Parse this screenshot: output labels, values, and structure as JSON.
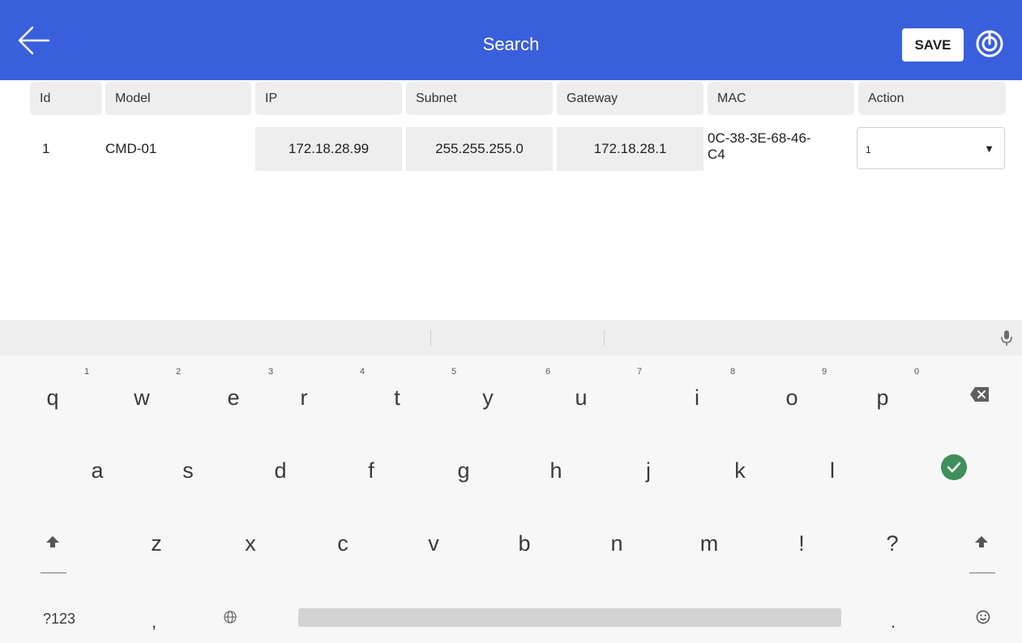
{
  "app_bar": {
    "title": "Search",
    "save_label": "SAVE",
    "back_icon": "back-arrow-icon",
    "power_icon": "power-icon",
    "color": "#3a5fdc"
  },
  "table": {
    "headers": [
      "Id",
      "Model",
      "IP",
      "Subnet",
      "Gateway",
      "MAC",
      "Action"
    ],
    "row": {
      "id": "1",
      "model": "CMD-01",
      "ip": "172.18.28.99",
      "subnet": "255.255.255.0",
      "gateway": "172.18.28.1",
      "mac_line1": "0C-38-3E-68-46-",
      "mac_line2": "C4",
      "action_value": "1",
      "action_caret": "▼"
    }
  },
  "keyboard": {
    "row1": [
      {
        "key": "q",
        "hint": "1"
      },
      {
        "key": "w",
        "hint": "2"
      },
      {
        "key": "e",
        "hint": "3"
      },
      {
        "key": "r",
        "hint": "4"
      },
      {
        "key": "t",
        "hint": "5"
      },
      {
        "key": "y",
        "hint": "6"
      },
      {
        "key": "u",
        "hint": "7"
      },
      {
        "key": "i",
        "hint": "8"
      },
      {
        "key": "o",
        "hint": "9"
      },
      {
        "key": "p",
        "hint": "0"
      }
    ],
    "row2": [
      "a",
      "s",
      "d",
      "f",
      "g",
      "h",
      "j",
      "k",
      "l"
    ],
    "row3": [
      "z",
      "x",
      "c",
      "v",
      "b",
      "n",
      "m",
      "!",
      "?"
    ],
    "row4": {
      "symbols": "?123",
      "comma": ",",
      "period": "."
    },
    "icons": {
      "backspace": "backspace-icon",
      "enter": "enter-check-icon",
      "shift": "shift-icon",
      "globe": "globe-icon",
      "emoji": "emoji-icon",
      "mic": "microphone-icon"
    },
    "enter_color": "#3f8f5b"
  }
}
